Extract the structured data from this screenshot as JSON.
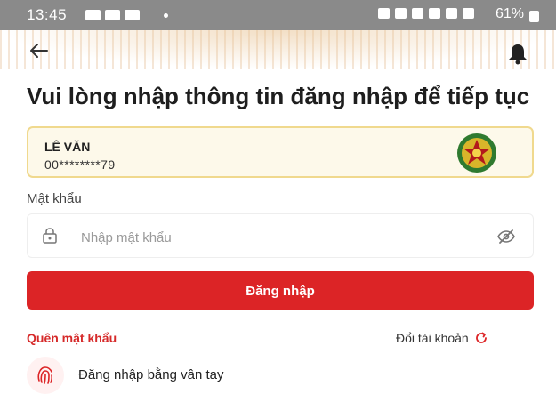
{
  "status_bar": {
    "time": "13:45",
    "battery": "61%"
  },
  "header": {
    "back_icon": "arrow-left-icon",
    "bell_icon": "bell-icon"
  },
  "heading": "Vui lòng nhập thông tin đăng nhập để tiếp tục",
  "account": {
    "name": "LÊ VĂN",
    "number": "00********79",
    "emblem_icon": "police-emblem-icon"
  },
  "password": {
    "label": "Mật khẩu",
    "placeholder": "Nhập mật khẩu",
    "value": ""
  },
  "login_button": "Đăng nhập",
  "forgot_password": "Quên mật khẩu",
  "switch_account": "Đổi tài khoản",
  "fingerprint_login": "Đăng nhập bằng vân tay",
  "colors": {
    "primary": "#dc2426",
    "card_bg": "#fdf9ea",
    "card_border": "#f0d98e"
  }
}
